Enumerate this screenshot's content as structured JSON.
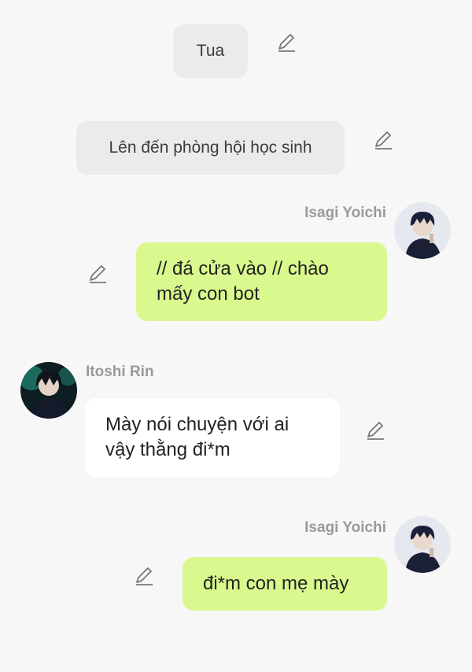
{
  "messages": [
    {
      "type": "narration",
      "text": "Tua"
    },
    {
      "type": "narration",
      "text": "Lên đến phòng hội học sinh"
    },
    {
      "type": "sent",
      "sender": "Isagi Yoichi",
      "text": "// đá cửa vào // chào mấy con bot"
    },
    {
      "type": "received",
      "sender": "Itoshi Rin",
      "text": "Mày nói chuyện với ai vậy thằng đi*m"
    },
    {
      "type": "sent",
      "sender": "Isagi Yoichi",
      "text": "đi*m con mẹ mày"
    }
  ],
  "icons": {
    "edit": "pencil-edit-icon"
  },
  "colors": {
    "background": "#f7f7f7",
    "narration_bubble": "#ebebeb",
    "sent_bubble": "#d9f88d",
    "received_bubble": "#ffffff",
    "sender_name": "#9a9a9a"
  }
}
